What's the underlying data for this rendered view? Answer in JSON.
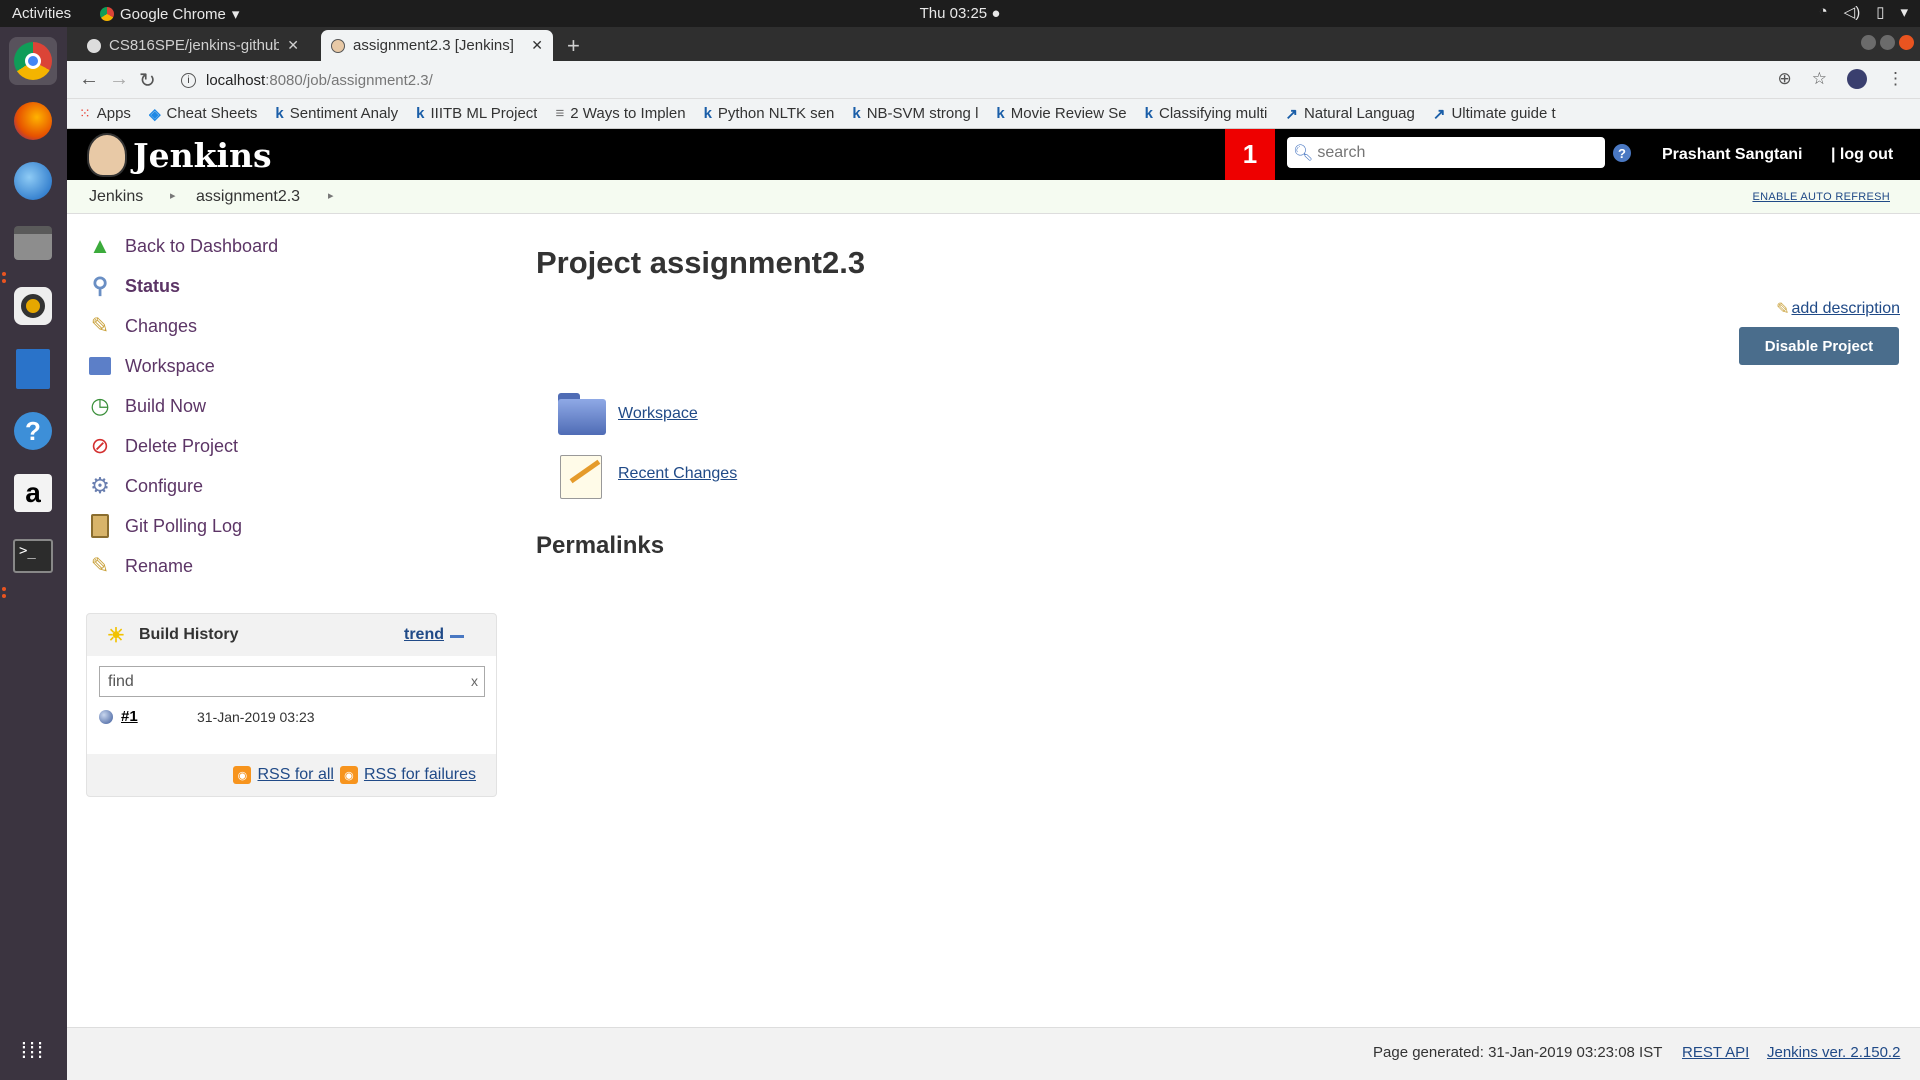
{
  "os": {
    "activities": "Activities",
    "app_name": "Google Chrome",
    "clock": "Thu 03:25"
  },
  "browser": {
    "tabs": [
      {
        "title": "CS816SPE/jenkins-github",
        "active": false
      },
      {
        "title": "assignment2.3 [Jenkins]",
        "active": true
      }
    ],
    "url_host": "localhost",
    "url_path": ":8080/job/assignment2.3/",
    "bookmarks": [
      {
        "label": "Apps"
      },
      {
        "label": "Cheat Sheets"
      },
      {
        "label": "Sentiment Analy"
      },
      {
        "label": "IIITB ML Project"
      },
      {
        "label": "2 Ways to Implen"
      },
      {
        "label": "Python NLTK sen"
      },
      {
        "label": "NB-SVM strong l"
      },
      {
        "label": "Movie Review Se"
      },
      {
        "label": "Classifying multi"
      },
      {
        "label": "Natural Languag"
      },
      {
        "label": "Ultimate guide t"
      }
    ]
  },
  "jenkins": {
    "logo_text": "Jenkins",
    "notification_count": "1",
    "search_placeholder": "search",
    "user": "Prashant Sangtani",
    "logout": "| log out",
    "breadcrumbs": [
      "Jenkins",
      "assignment2.3"
    ],
    "auto_refresh": "ENABLE AUTO REFRESH",
    "side_tasks": [
      "Back to Dashboard",
      "Status",
      "Changes",
      "Workspace",
      "Build Now",
      "Delete Project",
      "Configure",
      "Git Polling Log",
      "Rename"
    ],
    "build_history": {
      "title": "Build History",
      "trend": "trend",
      "find_placeholder": "find",
      "clear": "x",
      "builds": [
        {
          "number": "#1",
          "date": "31-Jan-2019 03:23"
        }
      ],
      "rss_all": "RSS for all",
      "rss_failures": "RSS for failures"
    },
    "main": {
      "title": "Project assignment2.3",
      "add_description": "add description",
      "disable_button": "Disable Project",
      "links": [
        "Workspace",
        "Recent Changes"
      ],
      "permalinks_heading": "Permalinks"
    },
    "footer": {
      "generated": "Page generated: 31-Jan-2019 03:23:08 IST",
      "rest_api": "REST API",
      "version": "Jenkins ver. 2.150.2"
    }
  }
}
